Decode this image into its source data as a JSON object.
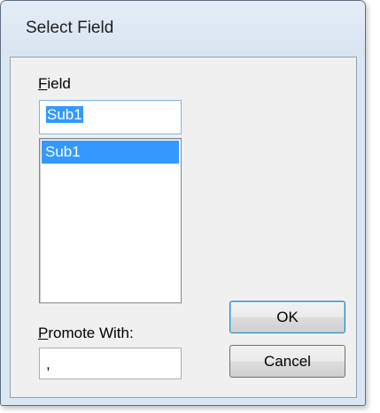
{
  "window": {
    "title": "Select Field"
  },
  "field": {
    "label_mnemonic": "F",
    "label_rest": "ield",
    "input_value": "Sub1",
    "list_items": [
      {
        "label": "Sub1",
        "selected": true
      }
    ]
  },
  "promote": {
    "label_mnemonic": "P",
    "label_rest": "romote With:",
    "input_value": ","
  },
  "buttons": {
    "ok_label": "OK",
    "cancel_label": "Cancel"
  },
  "colors": {
    "selection": "#3399ff",
    "dialog_face": "#f0f0f0",
    "frame": "#dbe6f3"
  }
}
